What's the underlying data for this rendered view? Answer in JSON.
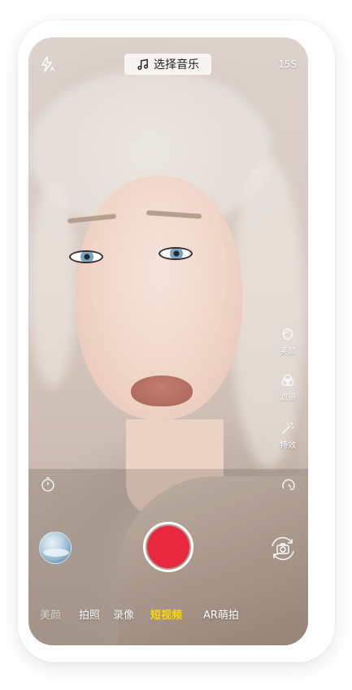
{
  "top_bar": {
    "music_label": "选择音乐",
    "duration_label": "15S"
  },
  "side_tools": [
    {
      "label": "美颜",
      "icon": "face-outline-icon"
    },
    {
      "label": "滤镜",
      "icon": "filter-circles-icon"
    },
    {
      "label": "特效",
      "icon": "magic-wand-icon"
    }
  ],
  "modes": [
    {
      "label": "美颜",
      "state": "faded"
    },
    {
      "label": "拍照",
      "state": "normal"
    },
    {
      "label": "录像",
      "state": "normal"
    },
    {
      "label": "短视频",
      "state": "active"
    },
    {
      "label": "AR萌拍",
      "state": "normal"
    }
  ],
  "colors": {
    "shutter": "#e8283f",
    "active_mode": "#ffd800"
  }
}
